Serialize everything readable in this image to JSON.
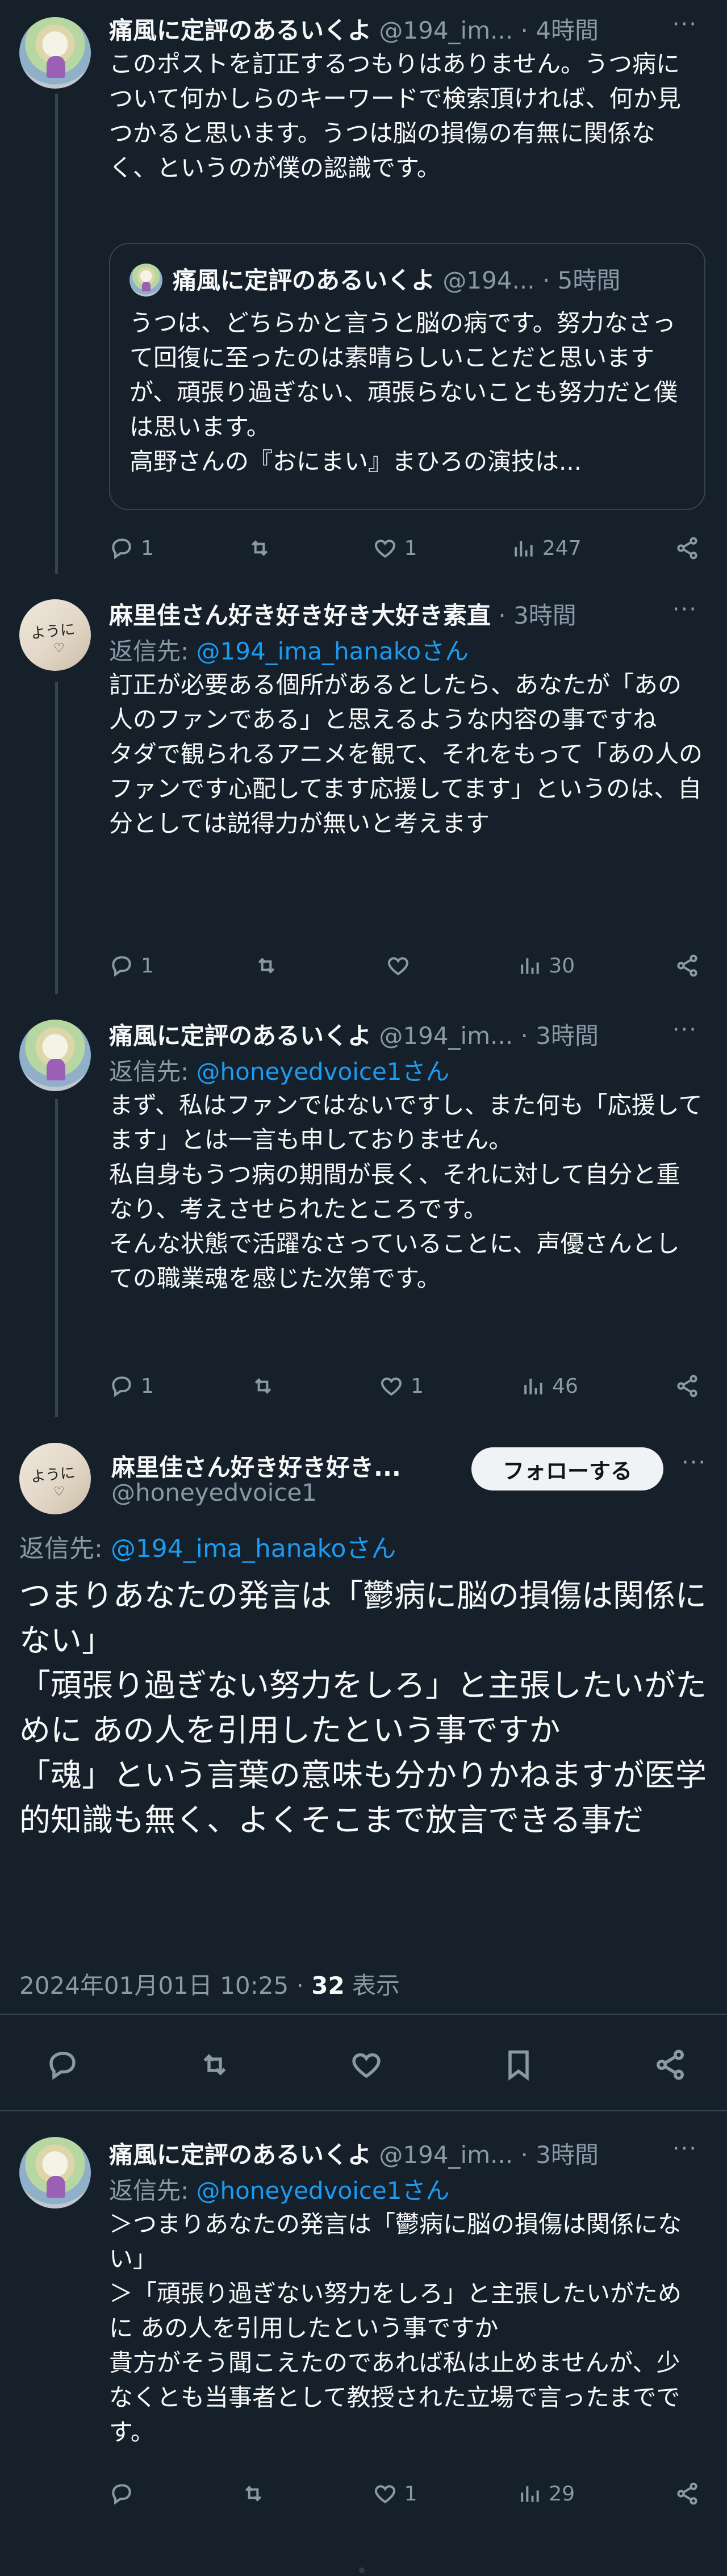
{
  "tweets": [
    {
      "name": "痛風に定評のあるいくよ",
      "handle": "@194_im...",
      "time": "· 4時間",
      "more": "···",
      "body": "このポストを訂正するつもりはありません。うつ病について何かしらのキーワードで検索頂ければ、何か見つかると思います。うつは脳の損傷の有無に関係なく、というのが僕の認識です。",
      "quote": {
        "name": "痛風に定評のあるいくよ",
        "handle": "@194...",
        "time": "· 5時間",
        "body": "うつは、どちらかと言うと脳の病です。努力なさって回復に至ったのは素晴らしいことだと思いますが、頑張り過ぎない、頑張らないことも努力だと僕は思います。\n高野さんの『おにまい』まひろの演技は..."
      },
      "replies": "1",
      "retweets": "",
      "likes": "1",
      "views": "247"
    },
    {
      "name": "麻里佳さん好き好き好き大好き素直",
      "time": "· 3時間",
      "more": "···",
      "reply_label": "返信先: ",
      "reply_to": "@194_ima_hanakoさん",
      "body": "訂正が必要ある個所があるとしたら、あなたが「あの人のファンである」と思えるような内容の事ですね\nタダで観られるアニメを観て、それをもって「あの人のファンです心配してます応援してます」というのは、自分としては説得力が無いと考えます",
      "replies": "1",
      "retweets": "",
      "likes": "",
      "views": "30"
    },
    {
      "name": "痛風に定評のあるいくよ",
      "handle": "@194_im...",
      "time": "· 3時間",
      "more": "···",
      "reply_label": "返信先: ",
      "reply_to": "@honeyedvoice1さん",
      "body": "まず、私はファンではないですし、また何も「応援してます」とは一言も申しておりません。\n私自身もうつ病の期間が長く、それに対して自分と重なり、考えさせられたところです。\nそんな状態で活躍なさっていることに、声優さんとしての職業魂を感じた次第です。",
      "replies": "1",
      "retweets": "",
      "likes": "1",
      "views": "46"
    }
  ],
  "main": {
    "name": "麻里佳さん好き好き好き...",
    "handle": "@honeyedvoice1",
    "follow": "フォローする",
    "more": "···",
    "reply_label": "返信先: ",
    "reply_to": "@194_ima_hanakoさん",
    "body": "つまりあなたの発言は「鬱病に脳の損傷は関係にない」\n「頑張り過ぎない努力をしろ」と主張したいがために あの人を引用したという事ですか\n「魂」という言葉の意味も分かりかねますが医学的知識も無く、よくそこまで放言できる事だ",
    "date": "2024年01月01日 10:25 · ",
    "views_count": "32",
    "views_label": " 表示"
  },
  "reply": {
    "name": "痛風に定評のあるいくよ",
    "handle": "@194_im...",
    "time": "· 3時間",
    "more": "···",
    "reply_label": "返信先: ",
    "reply_to": "@honeyedvoice1さん",
    "body": "＞つまりあなたの発言は「鬱病に脳の損傷は関係にない」\n＞「頑張り過ぎない努力をしろ」と主張したいがために あの人を引用したという事ですか\n貴方がそう聞こえたのであれば私は止めませんが、少なくとも当事者として教授された立場で言ったまでです。",
    "replies": "",
    "retweets": "",
    "likes": "1",
    "views": "29"
  },
  "avatar_scribble": "ように",
  "icons": [
    "reply-icon",
    "retweet-icon",
    "like-icon",
    "views-icon",
    "share-icon",
    "bookmark-icon"
  ]
}
